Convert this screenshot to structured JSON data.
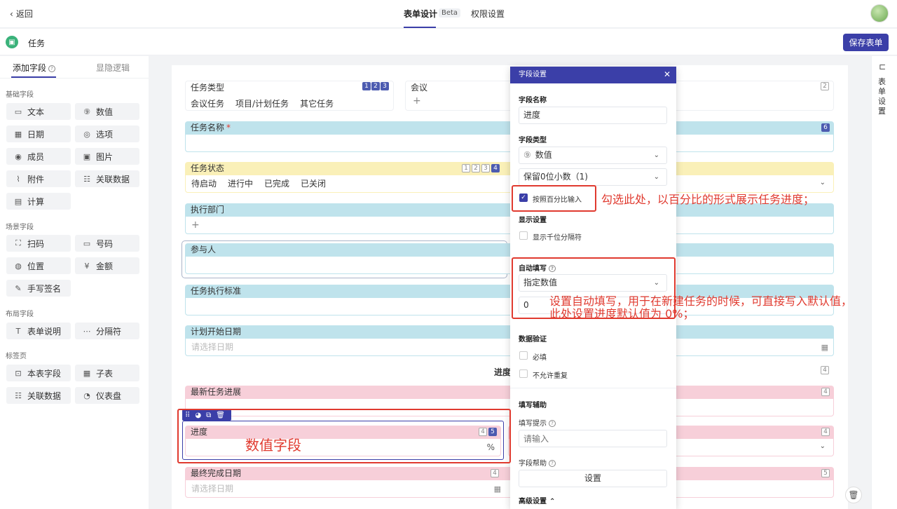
{
  "topbar": {
    "back_label": "返回",
    "tab_form_design": "表单设计",
    "beta_badge": "Beta",
    "tab_permissions": "权限设置"
  },
  "app": {
    "title": "任务",
    "save_label": "保存表单"
  },
  "left_panel": {
    "tabs": [
      "添加字段",
      "显隐逻辑"
    ],
    "sections": [
      {
        "title": "基础字段",
        "items": [
          {
            "label": "文本",
            "icon": "text-icon"
          },
          {
            "label": "数值",
            "icon": "number-icon"
          },
          {
            "label": "日期",
            "icon": "calendar-icon"
          },
          {
            "label": "选项",
            "icon": "option-icon"
          },
          {
            "label": "成员",
            "icon": "member-icon"
          },
          {
            "label": "图片",
            "icon": "image-icon"
          },
          {
            "label": "附件",
            "icon": "attachment-icon"
          },
          {
            "label": "关联数据",
            "icon": "link-data-icon"
          },
          {
            "label": "计算",
            "icon": "calculator-icon"
          }
        ]
      },
      {
        "title": "场景字段",
        "items": [
          {
            "label": "扫码",
            "icon": "scan-icon"
          },
          {
            "label": "号码",
            "icon": "serial-icon"
          },
          {
            "label": "位置",
            "icon": "location-icon"
          },
          {
            "label": "金额",
            "icon": "money-icon"
          },
          {
            "label": "手写签名",
            "icon": "signature-icon"
          }
        ]
      },
      {
        "title": "布局字段",
        "items": [
          {
            "label": "表单说明",
            "icon": "text-t-icon"
          },
          {
            "label": "分隔符",
            "icon": "divider-icon"
          }
        ]
      },
      {
        "title": "标签页",
        "items": [
          {
            "label": "本表字段",
            "icon": "tab-field-icon"
          },
          {
            "label": "子表",
            "icon": "table-icon"
          },
          {
            "label": "关联数据",
            "icon": "link-data-icon"
          },
          {
            "label": "仪表盘",
            "icon": "dashboard-icon"
          }
        ]
      }
    ]
  },
  "form": {
    "task_type": {
      "label": "任务类型",
      "options": [
        "会议任务",
        "项目/计划任务",
        "其它任务"
      ],
      "badges": [
        "1",
        "2",
        "3"
      ]
    },
    "meeting": {
      "label": "会议",
      "add": "+",
      "badge": "2"
    },
    "task_name": {
      "label": "任务名称",
      "required": "*",
      "badge": "6"
    },
    "task_status": {
      "label": "任务状态",
      "options": [
        "待启动",
        "进行中",
        "已完成",
        "已关闭"
      ],
      "badges": [
        "1",
        "2",
        "3",
        "4"
      ]
    },
    "department": {
      "label": "执行部门",
      "add": "+"
    },
    "participants": {
      "label": "参与人"
    },
    "standard": {
      "label": "任务执行标准"
    },
    "plan_start": {
      "label": "计划开始日期",
      "placeholder": "请选择日期"
    },
    "progress_section": {
      "label": "进度",
      "badge": "4"
    },
    "latest_progress": {
      "label": "最新任务进展",
      "badge": "4"
    },
    "progress": {
      "label": "进度",
      "unit": "%",
      "badges": [
        "4",
        "5"
      ]
    },
    "final_date": {
      "label": "最终完成日期",
      "placeholder": "请选择日期",
      "badge": "4",
      "badge_right": "5"
    },
    "right_badge_row4": "4"
  },
  "dialog": {
    "title": "字段设置",
    "field_name_label": "字段名称",
    "field_name_value": "进度",
    "field_type_label": "字段类型",
    "field_type_value": "数值",
    "decimal_value": "保留0位小数（1)",
    "percent_label": "按照百分比输入",
    "display_label": "显示设置",
    "thousands_label": "显示千位分隔符",
    "autofill_label": "自动填写",
    "autofill_mode": "指定数值",
    "autofill_value": "0",
    "validation_label": "数据验证",
    "required_label": "必填",
    "unique_label": "不允许重复",
    "assist_label": "填写辅助",
    "hint_label": "填写提示",
    "hint_placeholder": "请输入",
    "help_label": "字段帮助",
    "help_button": "设置",
    "advanced_label": "高级设置"
  },
  "annotations": {
    "percent_note": "勾选此处，以百分比的形式展示任务进度；",
    "autofill_note_1": "设置自动填写，用于在新建任务的时候，可直接写入默认值，",
    "autofill_note_2": "此处设置进度默认值为 0%；",
    "numeric_note": "数值字段"
  },
  "right_sidebar": {
    "label": "表单设置"
  },
  "colors": {
    "accent": "#3b3fa8",
    "annotation": "#e03a2f",
    "cyan": "#bfe3ec",
    "yellow": "#faf0b8",
    "pink": "#f7cfd9"
  }
}
